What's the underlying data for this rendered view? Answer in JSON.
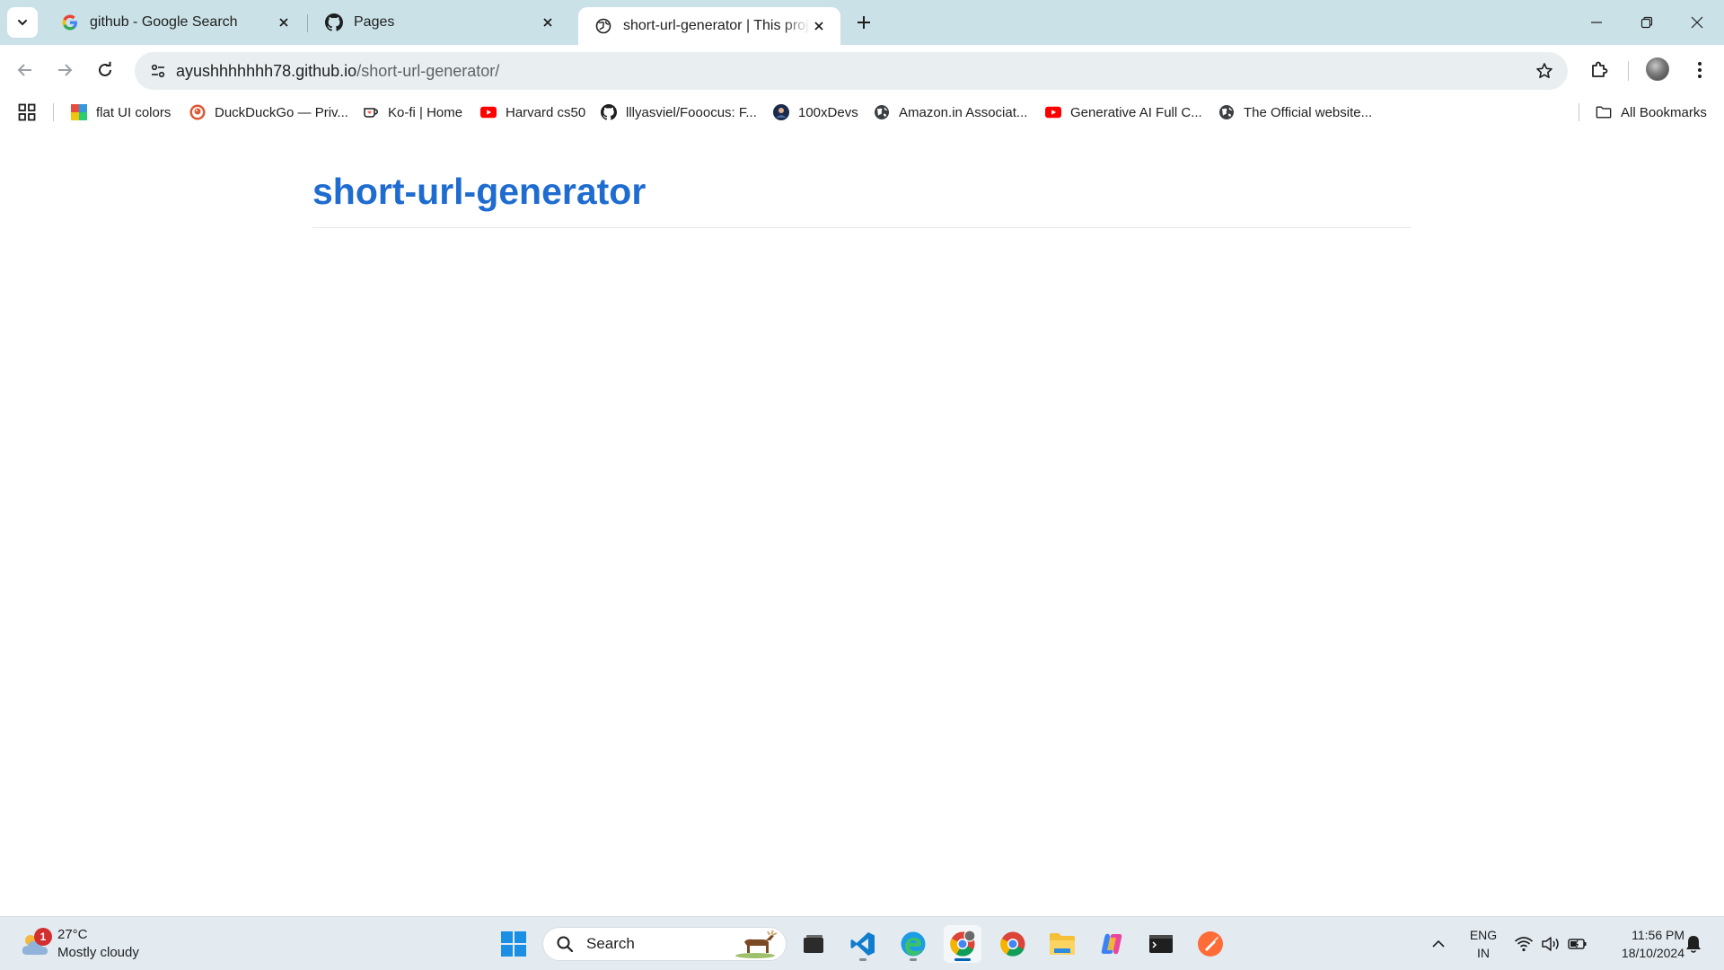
{
  "browser": {
    "tabs": [
      {
        "title": "github - Google Search",
        "icon": "google-icon",
        "active": false
      },
      {
        "title": "Pages",
        "icon": "github-icon",
        "active": false
      },
      {
        "title": "short-url-generator | This project",
        "icon": "globe-icon",
        "active": true
      }
    ],
    "address": {
      "host": "ayushhhhhhh78.github.io",
      "path": "/short-url-generator/"
    },
    "bookmarks": [
      {
        "label": "flat UI colors",
        "icon": "flat-ui-icon"
      },
      {
        "label": "DuckDuckGo — Priv...",
        "icon": "duckduckgo-icon"
      },
      {
        "label": "Ko-fi | Home",
        "icon": "kofi-icon"
      },
      {
        "label": "Harvard cs50",
        "icon": "youtube-icon"
      },
      {
        "label": "lllyasviel/Fooocus: F...",
        "icon": "github-icon"
      },
      {
        "label": "100xDevs",
        "icon": "100xdevs-icon"
      },
      {
        "label": "Amazon.in Associat...",
        "icon": "globe-icon"
      },
      {
        "label": "Generative AI Full C...",
        "icon": "youtube-icon"
      },
      {
        "label": "The Official website...",
        "icon": "globe-icon"
      }
    ],
    "all_bookmarks_label": "All Bookmarks"
  },
  "page": {
    "title": "short-url-generator"
  },
  "taskbar": {
    "weather": {
      "temp": "27°C",
      "condition": "Mostly cloudy",
      "badge": "1"
    },
    "search_label": "Search",
    "language": {
      "line1": "ENG",
      "line2": "IN"
    },
    "clock": {
      "time": "11:56 PM",
      "date": "18/10/2024"
    },
    "apps": [
      "windows-start-icon",
      "task-view-icon",
      "vscode-icon",
      "edge-icon",
      "chrome-profile-icon",
      "chrome-icon",
      "file-explorer-icon",
      "copilot-icon",
      "terminal-icon",
      "postman-icon"
    ]
  },
  "colors": {
    "tabstrip": "#c9e1e7",
    "page_title": "#1f6cd0",
    "taskbar": "#e3ebf1"
  }
}
